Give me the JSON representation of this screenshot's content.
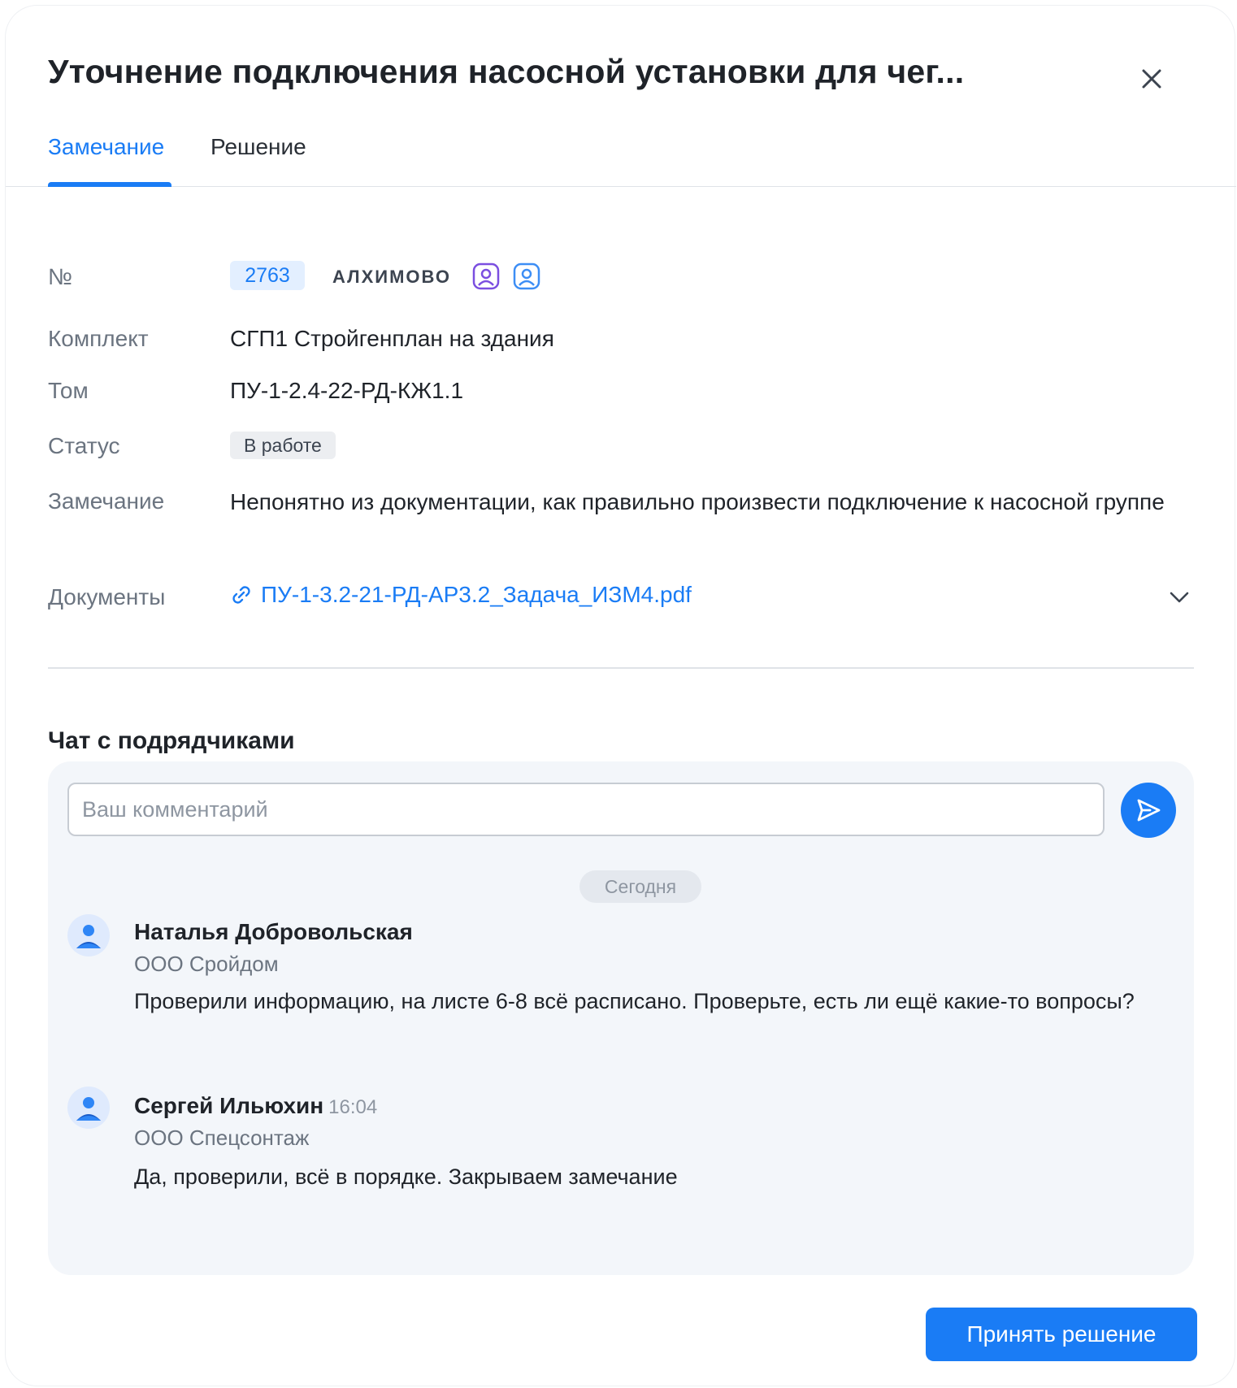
{
  "header": {
    "title": "Уточнение подключения насосной установки для чег..."
  },
  "tabs": [
    {
      "label": "Замечание",
      "active": true
    },
    {
      "label": "Решение",
      "active": false
    }
  ],
  "details": {
    "number": {
      "label": "№",
      "value": "2763",
      "org": "АЛХИМОВО"
    },
    "kit": {
      "label": "Комплект",
      "value": "СГП1 Стройгенплан на здания"
    },
    "volume": {
      "label": "Том",
      "value": "ПУ-1-2.4-22-РД-КЖ1.1"
    },
    "status": {
      "label": "Статус",
      "value": "В работе"
    },
    "remark": {
      "label": "Замечание",
      "value": "Непонятно из документации, как правильно произвести подключение к насосной группе"
    },
    "documents": {
      "label": "Документы",
      "file": "ПУ-1-3.2-21-РД-АР3.2_Задача_ИЗМ4.pdf"
    }
  },
  "chat": {
    "title": "Чат с подрядчиками",
    "placeholder": "Ваш комментарий",
    "date_label": "Сегодня",
    "messages": [
      {
        "author": "Наталья Добровольская",
        "time": "",
        "company": "ООО Сройдом",
        "text": "Проверили информацию, на листе 6-8 всё расписано. Проверьте, есть ли ещё какие-то вопросы?"
      },
      {
        "author": "Сергей Ильюхин",
        "time": "16:04",
        "company": "ООО Спецсонтаж",
        "text": "Да, проверили, всё в порядке. Закрываем замечание"
      }
    ]
  },
  "footer": {
    "accept_label": "Принять решение"
  },
  "colors": {
    "accent": "#1a7cf5",
    "badge_bg": "#e3efff",
    "panel_bg": "#f3f6fa",
    "purple_icon": "#7b4fe0"
  },
  "icons": [
    "close-icon",
    "person-icon",
    "link-icon",
    "chevron-down-icon",
    "send-icon",
    "user-avatar-icon"
  ]
}
